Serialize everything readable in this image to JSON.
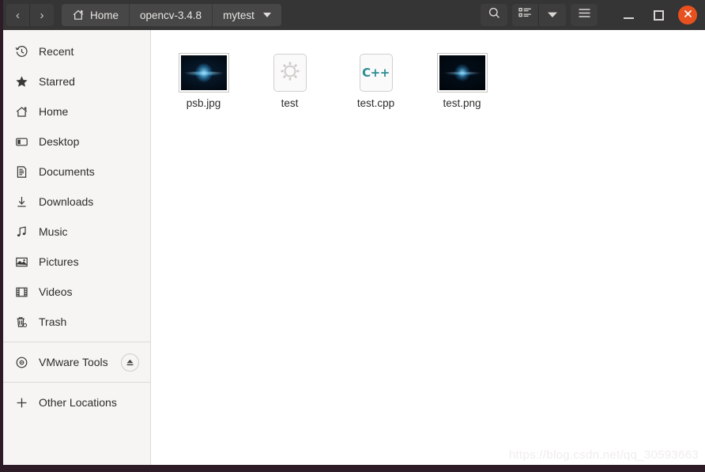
{
  "window": {
    "title": "mytest",
    "accent_orange": "#e8511f",
    "header_bg": "#353535",
    "sidebar_bg": "#f6f5f4",
    "content_bg": "#ffffff"
  },
  "header": {
    "nav": {
      "back_label": "‹",
      "back_name": "back-button",
      "forward_label": "›",
      "forward_name": "forward-button"
    },
    "breadcrumbs": [
      {
        "label": "Home",
        "icon": "home-icon",
        "has_caret": false
      },
      {
        "label": "opencv-3.4.8",
        "icon": "",
        "has_caret": false
      },
      {
        "label": "mytest",
        "icon": "",
        "has_caret": true
      }
    ],
    "actions": [
      {
        "name": "search-icon",
        "label": "search"
      },
      {
        "name": "list-view-icon",
        "label": "list view"
      },
      {
        "name": "chevron-down-icon",
        "label": "view options"
      },
      {
        "name": "hamburger-menu-icon",
        "label": "menu"
      }
    ],
    "window_controls": [
      {
        "name": "minimize-button",
        "label": "minimize"
      },
      {
        "name": "maximize-button",
        "label": "maximize"
      },
      {
        "name": "close-button",
        "label": "close"
      }
    ]
  },
  "sidebar": {
    "items": [
      {
        "label": "Recent",
        "icon": "clock-icon"
      },
      {
        "label": "Starred",
        "icon": "star-icon"
      },
      {
        "label": "Home",
        "icon": "home-icon"
      },
      {
        "label": "Desktop",
        "icon": "desktop-icon"
      },
      {
        "label": "Documents",
        "icon": "documents-icon"
      },
      {
        "label": "Downloads",
        "icon": "download-icon"
      },
      {
        "label": "Music",
        "icon": "music-note-icon"
      },
      {
        "label": "Pictures",
        "icon": "picture-icon"
      },
      {
        "label": "Videos",
        "icon": "film-icon"
      },
      {
        "label": "Trash",
        "icon": "trash-icon"
      }
    ],
    "devices": [
      {
        "label": "VMware Tools",
        "icon": "disc-icon",
        "eject": true,
        "eject_name": "eject-button"
      }
    ],
    "other": [
      {
        "label": "Other Locations",
        "icon": "plus-icon"
      }
    ]
  },
  "files": [
    {
      "name": "psb.jpg",
      "kind": "image",
      "icon": "image-thumbnail"
    },
    {
      "name": "test",
      "kind": "executable",
      "icon": "gear-icon"
    },
    {
      "name": "test.cpp",
      "kind": "source",
      "icon": "cpp-file-icon",
      "badge": "C++"
    },
    {
      "name": "test.png",
      "kind": "image",
      "icon": "image-thumbnail"
    }
  ],
  "watermark": {
    "text": "https://blog.csdn.net/qq_30593663"
  }
}
